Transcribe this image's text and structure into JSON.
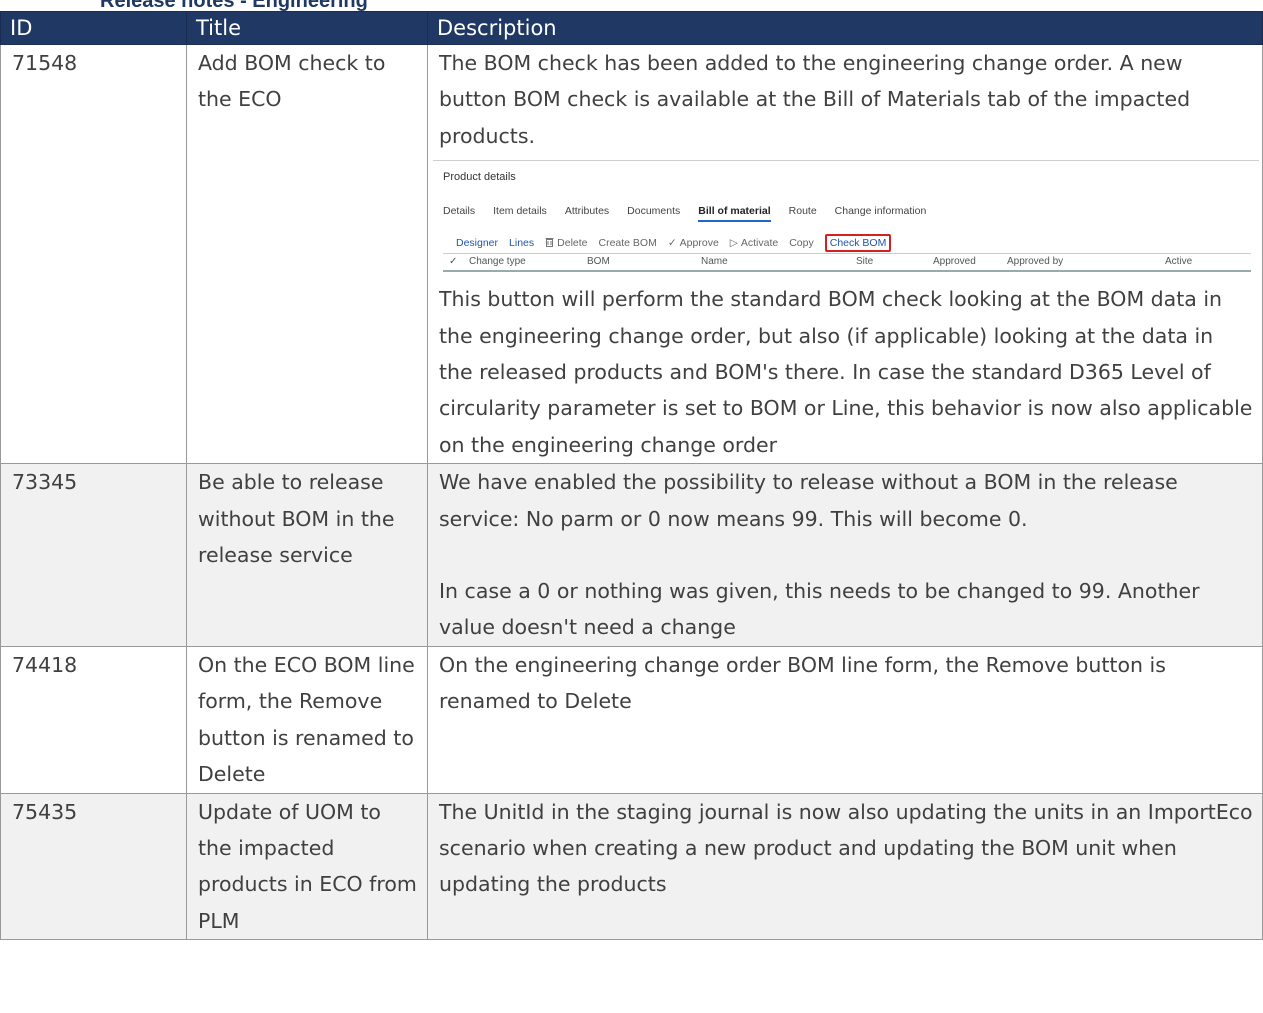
{
  "heading_fragment": "Release notes - Engineering",
  "columns": {
    "id": "ID",
    "title": "Title",
    "description": "Description"
  },
  "rows": [
    {
      "id": "71548",
      "title": "Add BOM check to the ECO",
      "desc_intro": "The BOM check has been added to the engineering change order. A new button BOM check is available at the Bill of Materials tab of the impacted products.",
      "desc_after": "This button will perform the standard BOM check looking at the BOM data in the engineering change order, but also (if applicable) looking at the data in the released products and BOM's there. In case the standard D365 Level of circularity parameter is set to BOM or Line, this behavior is now also applicable on the engineering change order"
    },
    {
      "id": "73345",
      "title": "Be able to release without BOM in the release service",
      "desc_p1": "We have enabled the possibility to release without a BOM in the release service: No parm or 0 now means 99. This will become 0.",
      "desc_p2": "In case a 0 or nothing was given, this needs to be changed to 99. Another value doesn't need a change"
    },
    {
      "id": "74418",
      "title": "On the ECO BOM line form, the Remove button is renamed to Delete",
      "desc": "On the engineering change order BOM line form, the Remove button is renamed to Delete"
    },
    {
      "id": "75435",
      "title": "Update of UOM to the impacted products in ECO from PLM",
      "desc": "The UnitId in the staging journal is now also updating the units in an ImportEco scenario when creating a new product and updating the BOM unit when updating the products"
    }
  ],
  "screenshot": {
    "title": "Product details",
    "tabs": [
      "Details",
      "Item details",
      "Attributes",
      "Documents",
      "Bill of material",
      "Route",
      "Change information"
    ],
    "active_tab": "Bill of material",
    "toolbar": {
      "designer": "Designer",
      "lines": "Lines",
      "delete": "Delete",
      "create_bom": "Create BOM",
      "approve": "Approve",
      "activate": "Activate",
      "copy": "Copy",
      "check_bom": "Check BOM"
    },
    "grid_columns": [
      "Change type",
      "BOM",
      "Name",
      "Site",
      "Approved",
      "Approved by",
      "Active"
    ],
    "highlight_color": "#d62020"
  },
  "colors": {
    "header_bg": "#203864",
    "alt_row_bg": "#f1f1f1",
    "border": "#999999"
  }
}
